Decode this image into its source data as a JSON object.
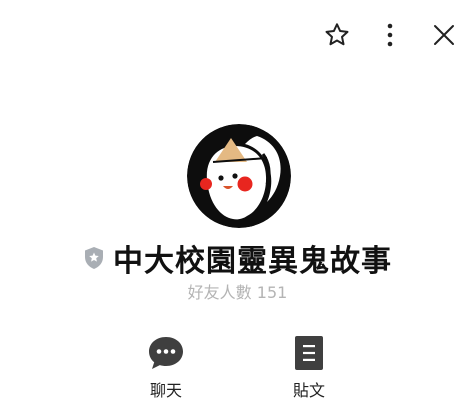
{
  "header": {
    "favorite_icon": "star-outline-icon",
    "more_icon": "more-vertical-icon",
    "close_icon": "close-icon"
  },
  "profile": {
    "name": "中大校園靈異鬼故事",
    "badge_icon": "verified-shield-icon",
    "friends_text": "好友人數 151"
  },
  "actions": [
    {
      "label": "聊天",
      "icon": "chat-bubble-icon"
    },
    {
      "label": "貼文",
      "icon": "document-icon"
    }
  ],
  "colors": {
    "accent_dark": "#3f3f3f",
    "muted_text": "#b4b4b4",
    "badge": "#a9aeb4",
    "avatar_cheek": "#e8261f",
    "avatar_hat": "#e4b983"
  }
}
